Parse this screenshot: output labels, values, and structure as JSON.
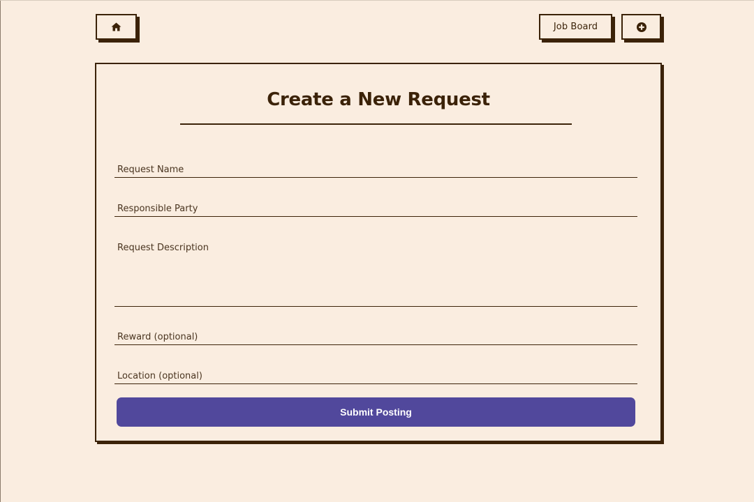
{
  "nav": {
    "home_icon": "home-icon",
    "job_board_label": "Job Board",
    "add_icon": "plus-circle-icon"
  },
  "form": {
    "title": "Create a New Request",
    "fields": [
      {
        "placeholder": "Request Name",
        "value": ""
      },
      {
        "placeholder": "Responsible Party",
        "value": ""
      },
      {
        "placeholder": "Request Description",
        "value": ""
      },
      {
        "placeholder": "Reward (optional)",
        "value": ""
      },
      {
        "placeholder": "Location (optional)",
        "value": ""
      }
    ],
    "submit_label": "Submit Posting"
  },
  "colors": {
    "background": "#faede0",
    "ink": "#3b2208",
    "accent": "#51489c"
  }
}
